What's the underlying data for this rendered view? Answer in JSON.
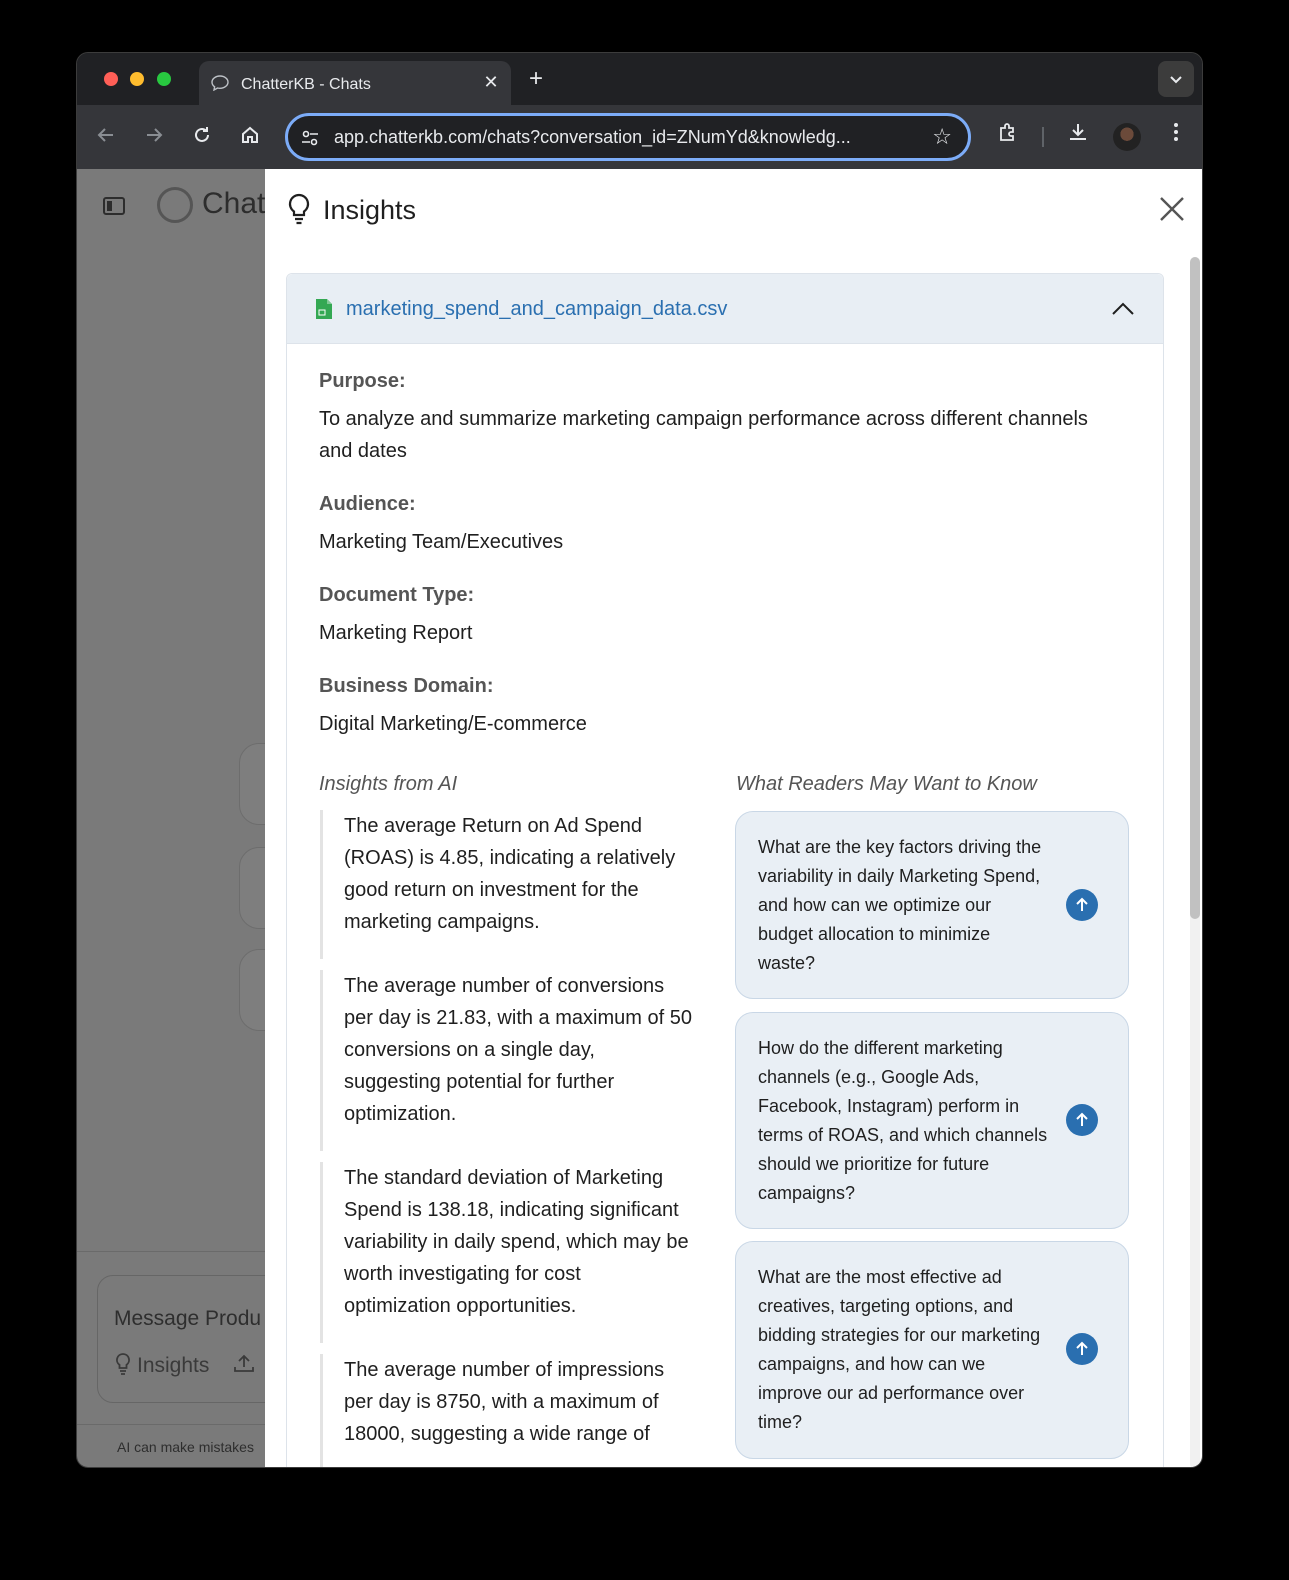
{
  "browser": {
    "tab_title": "ChatterKB - Chats",
    "tab_close": "✕",
    "new_tab": "+",
    "url": "app.chatterkb.com/chats?conversation_id=ZNumYd&knowledg..."
  },
  "background": {
    "brand": "Chat",
    "message_placeholder": "Message Produ",
    "insights_button": "Insights",
    "disclaimer": "AI can make mistakes"
  },
  "panel": {
    "title": "Insights",
    "file": {
      "name": "marketing_spend_and_campaign_data.csv",
      "purpose_label": "Purpose:",
      "purpose": "To analyze and summarize marketing campaign performance across different channels and dates",
      "audience_label": "Audience:",
      "audience": "Marketing Team/Executives",
      "doctype_label": "Document Type:",
      "doctype": "Marketing Report",
      "domain_label": "Business Domain:",
      "domain": "Digital Marketing/E-commerce"
    },
    "insights_title": "Insights from AI",
    "insights": [
      "The average Return on Ad Spend (ROAS) is 4.85, indicating a relatively good return on investment for the marketing campaigns.",
      "The average number of conversions per day is 21.83, with a maximum of 50 conversions on a single day, suggesting potential for further optimization.",
      "The standard deviation of Marketing Spend is 138.18, indicating significant variability in daily spend, which may be worth investigating for cost optimization opportunities.",
      "The average number of impressions per day is 8750, with a maximum of 18000, suggesting a wide range of"
    ],
    "questions_title": "What Readers May Want to Know",
    "questions": [
      "What are the key factors driving the variability in daily Marketing Spend, and how can we optimize our budget allocation to minimize waste?",
      "How do the different marketing channels (e.g., Google Ads, Facebook, Instagram) perform in terms of ROAS, and which channels should we prioritize for future campaigns?",
      "What are the most effective ad creatives, targeting options, and bidding strategies for our marketing campaigns, and how can we improve our ad performance over time?"
    ]
  },
  "colors": {
    "accent": "#2a6fb0",
    "question_bg": "#e9eff5",
    "file_header_bg": "#e8eef4",
    "overlay": "#7a7a7a"
  }
}
